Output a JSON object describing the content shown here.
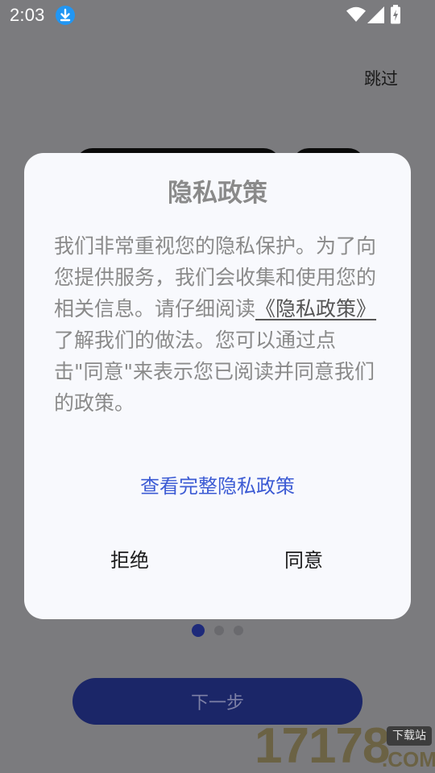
{
  "status_bar": {
    "time": "2:03",
    "icons": [
      "download-icon",
      "wifi-icon",
      "signal-icon",
      "battery-charging-icon"
    ]
  },
  "onboarding": {
    "skip_label": "跳过",
    "next_label": "下一步",
    "page_count": 3,
    "active_page": 1
  },
  "dialog": {
    "title": "隐私政策",
    "body_before_link": "我们非常重视您的隐私保护。为了向您提供服务，我们会收集和使用您的相关信息。请仔细阅读",
    "policy_link": "《隐私政策》",
    "body_after_link": "了解我们的做法。您可以通过点击\"同意\"来表示您已阅读并同意我们的政策。",
    "view_full_link": "查看完整隐私政策",
    "reject_label": "拒绝",
    "agree_label": "同意"
  },
  "watermark": {
    "digits": "17178",
    "tag": "下载站",
    "domain": ".COM"
  },
  "colors": {
    "overlay_background": "#7b7b7e",
    "dialog_background": "#f8f9fd",
    "link_blue": "#3c5bd4",
    "primary_dark_blue": "#1b2668",
    "status_download_blue": "#2196f3"
  }
}
